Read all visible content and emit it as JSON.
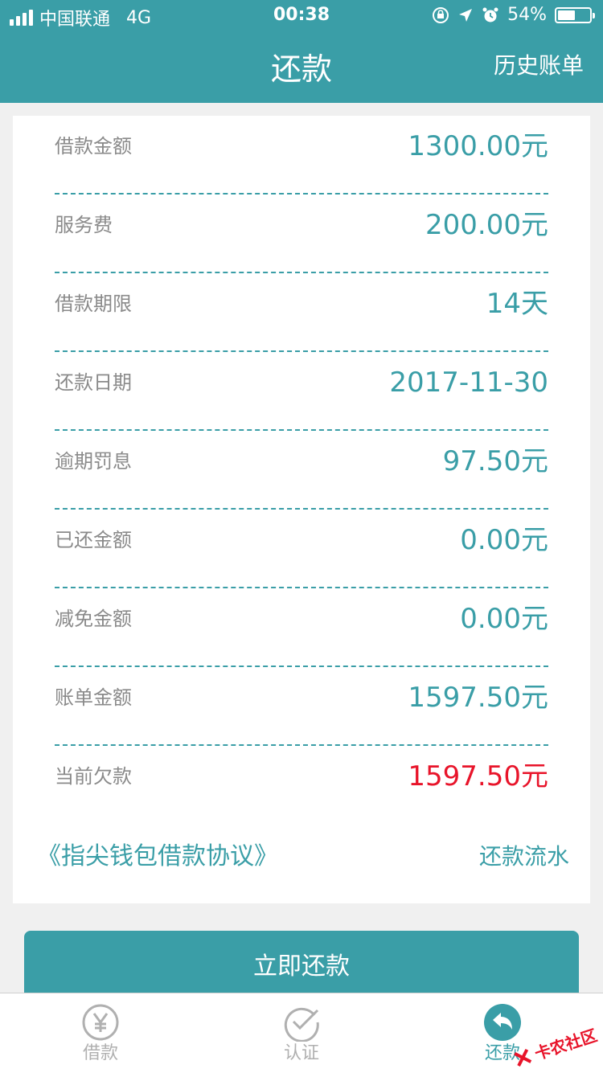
{
  "status_bar": {
    "carrier": "中国联通",
    "network": "4G",
    "time": "00:38",
    "battery_percent": "54%",
    "battery_level": 0.54
  },
  "nav": {
    "title": "还款",
    "history_label": "历史账单"
  },
  "details": [
    {
      "label": "借款金额",
      "value": "1300.00元"
    },
    {
      "label": "服务费",
      "value": "200.00元"
    },
    {
      "label": "借款期限",
      "value": "14天"
    },
    {
      "label": "还款日期",
      "value": "2017-11-30"
    },
    {
      "label": "逾期罚息",
      "value": "97.50元"
    },
    {
      "label": "已还金额",
      "value": "0.00元"
    },
    {
      "label": "减免金额",
      "value": "0.00元"
    },
    {
      "label": "账单金额",
      "value": "1597.50元"
    },
    {
      "label": "当前欠款",
      "value": "1597.50元"
    }
  ],
  "links": {
    "agreement": "《指尖钱包借款协议》",
    "repayment_flow": "还款流水"
  },
  "pay_button_label": "立即还款",
  "tabs": [
    {
      "label": "借款",
      "icon": "yen-icon"
    },
    {
      "label": "认证",
      "icon": "check-circle-icon"
    },
    {
      "label": "还款",
      "icon": "return-arrow-icon"
    }
  ],
  "watermark": "卡农社区",
  "colors": {
    "brand": "#3a9ea7",
    "debt": "#e8142a",
    "label": "#8a8a8a",
    "inactive_tab": "#b0b0b0"
  }
}
